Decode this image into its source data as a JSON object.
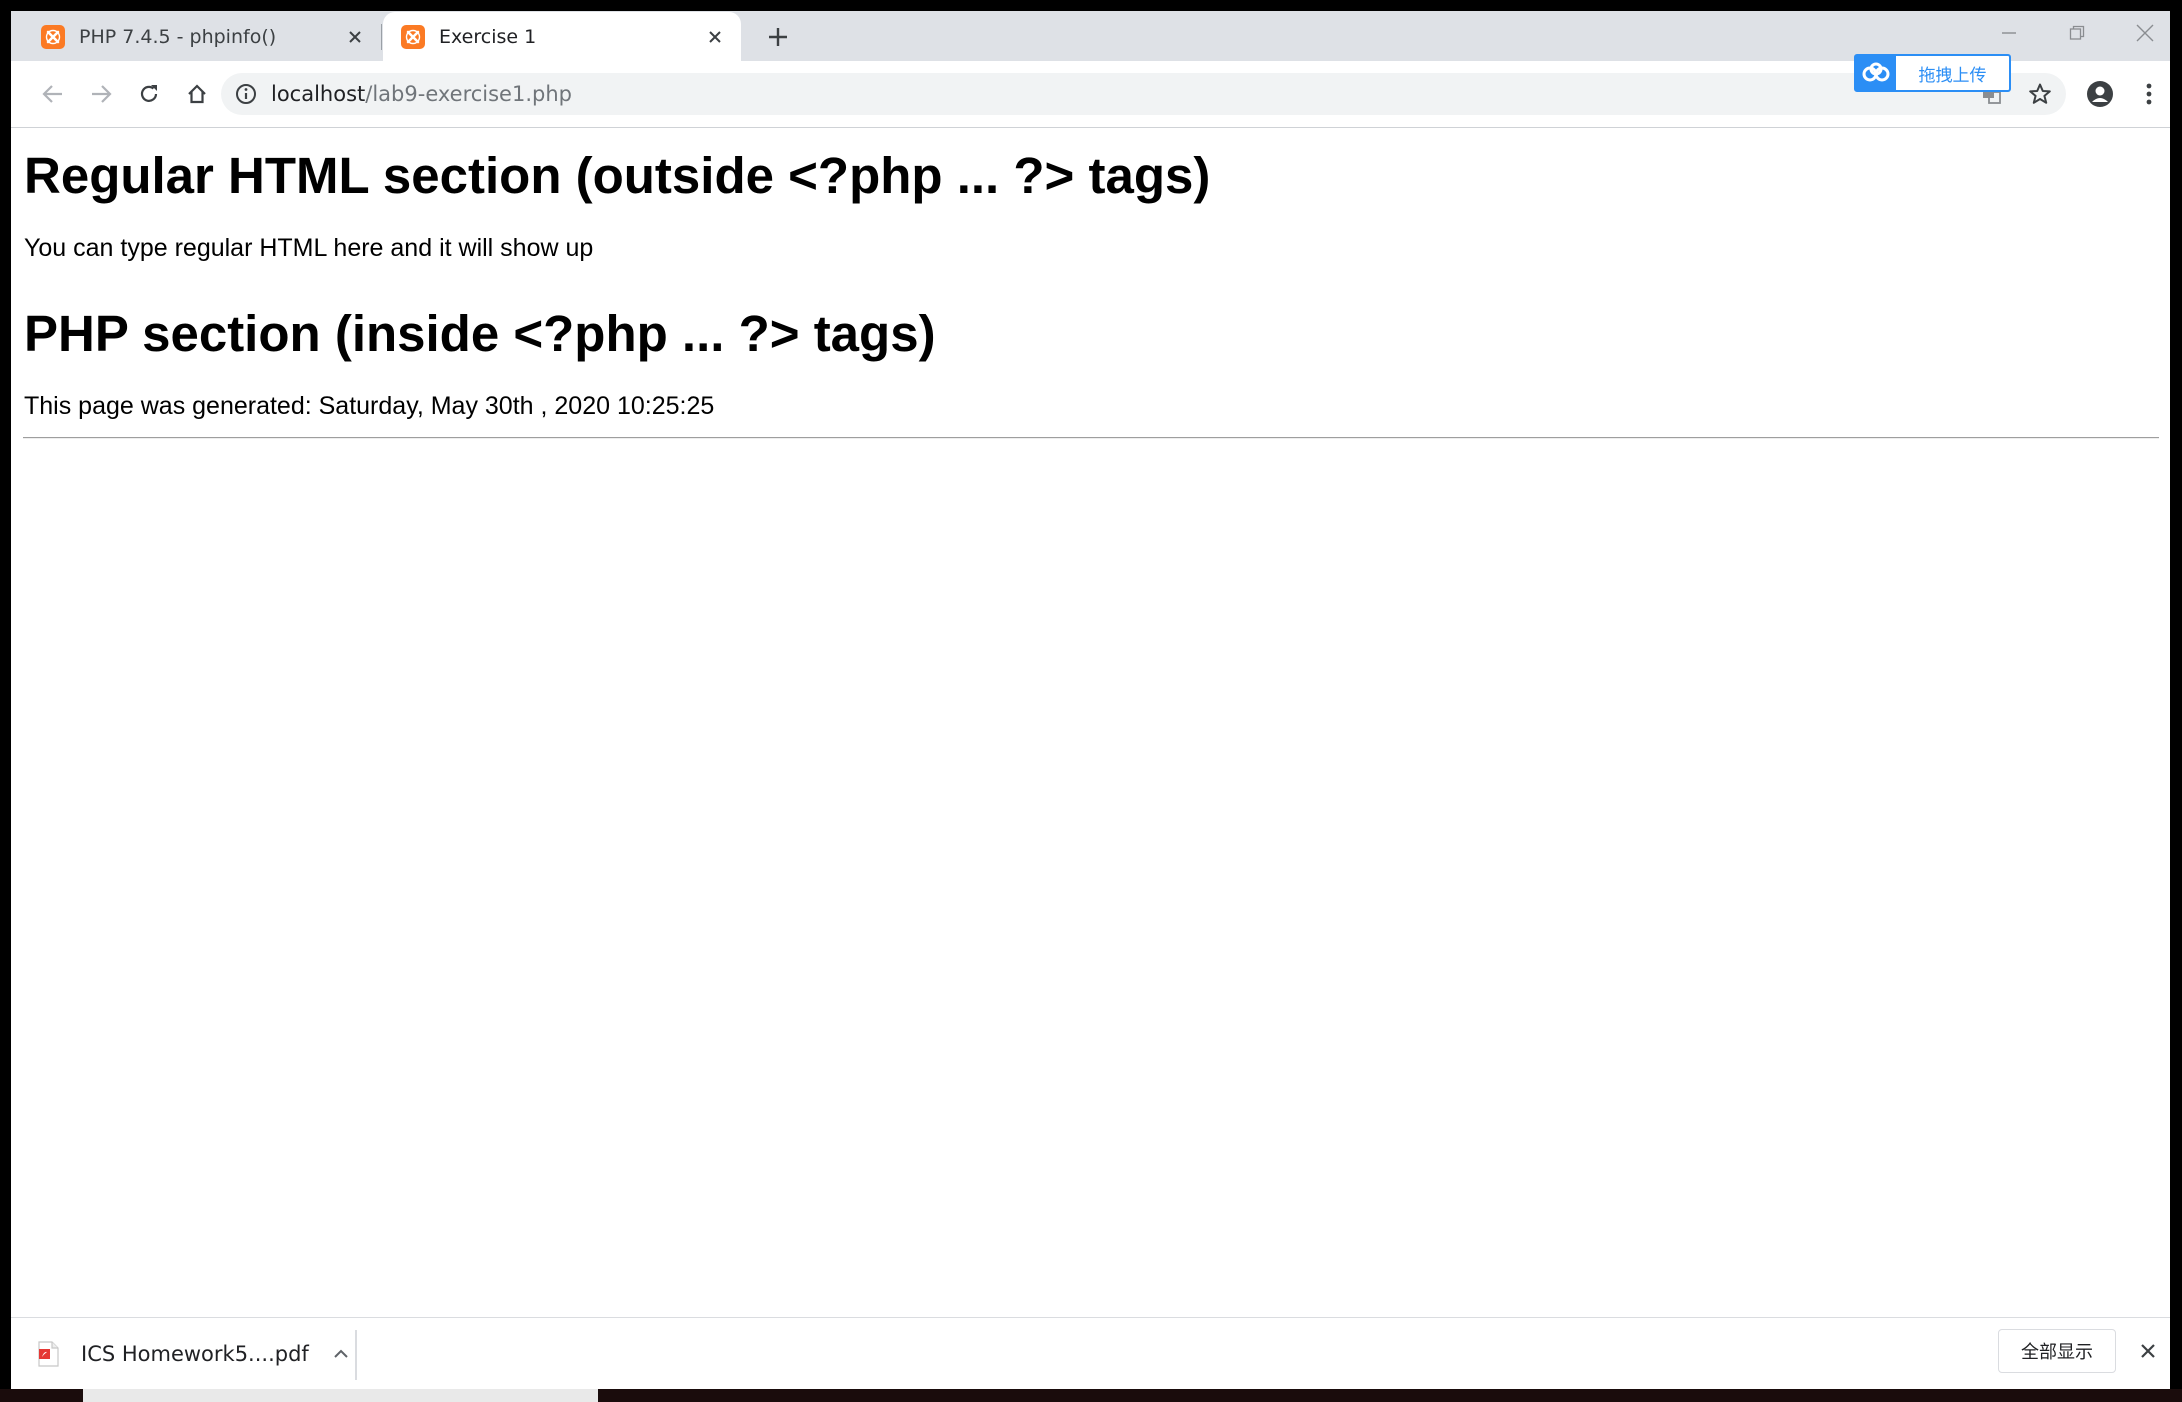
{
  "tabs": [
    {
      "title": "PHP 7.4.5 - phpinfo()",
      "icon": "xampp-icon",
      "active": false
    },
    {
      "title": "Exercise 1",
      "icon": "xampp-icon",
      "active": true
    }
  ],
  "omnibox": {
    "host": "localhost",
    "path": "/lab9-exercise1.php"
  },
  "upload_widget": {
    "label": "拖拽上传"
  },
  "page": {
    "heading1": "Regular HTML section (outside <?php ... ?> tags)",
    "paragraph1": "You can type regular HTML here and it will show up",
    "heading2": "PHP section (inside <?php ... ?> tags)",
    "paragraph2": "This page was generated: Saturday, May 30th , 2020 10:25:25"
  },
  "downloads": {
    "items": [
      {
        "name": "ICS Homework5....pdf",
        "icon": "pdf-file-icon"
      }
    ],
    "show_all": "全部显示"
  },
  "colors": {
    "accent_orange": "#fb7a24",
    "upload_blue": "#2b8ef5",
    "tabstrip": "#dee1e6"
  }
}
